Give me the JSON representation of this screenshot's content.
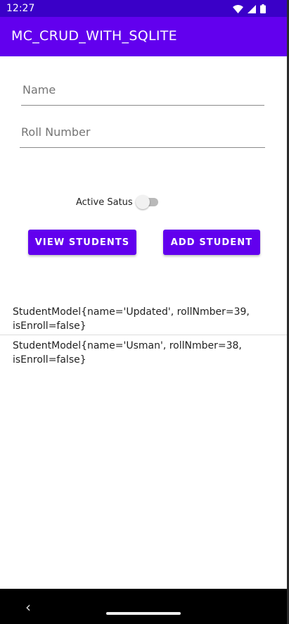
{
  "status_bar": {
    "time": "12:27"
  },
  "app_bar": {
    "title": "MC_CRUD_WITH_SQLITE"
  },
  "form": {
    "name_placeholder": "Name",
    "roll_placeholder": "Roll Number",
    "switch_label": "Active Satus",
    "switch_on": false
  },
  "buttons": {
    "view": "VIEW STUDENTS",
    "add": "ADD STUDENT"
  },
  "students": [
    "StudentModel{name='Updated', rollNmber=39, isEnroll=false}",
    "StudentModel{name='Usman', rollNmber=38, isEnroll=false}"
  ],
  "colors": {
    "primary": "#6200ee",
    "primary_dark": "#3700b3"
  }
}
